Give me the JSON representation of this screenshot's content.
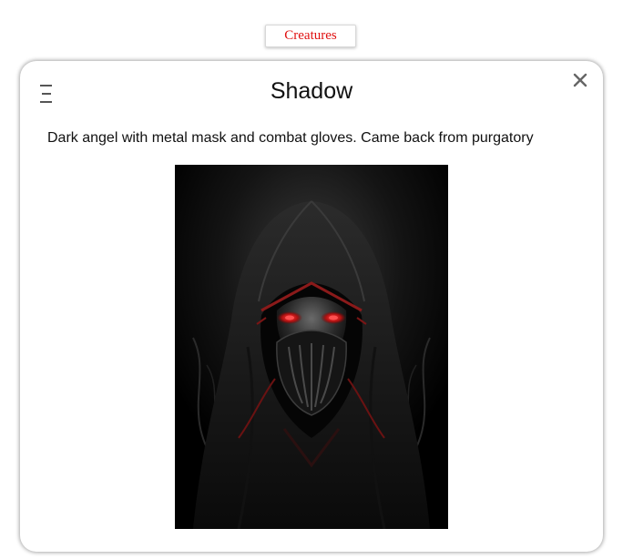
{
  "nav": {
    "tab_label": "Creatures",
    "tab_color": "#e01010"
  },
  "card": {
    "title": "Shadow",
    "description": "Dark angel with metal mask and combat gloves. Came back from purgatory",
    "menu_icon": "menu-icon",
    "close_icon": "close-icon",
    "image_subject": "hooded-dark-angel-with-metal-mask",
    "eye_color": "#e02020"
  }
}
